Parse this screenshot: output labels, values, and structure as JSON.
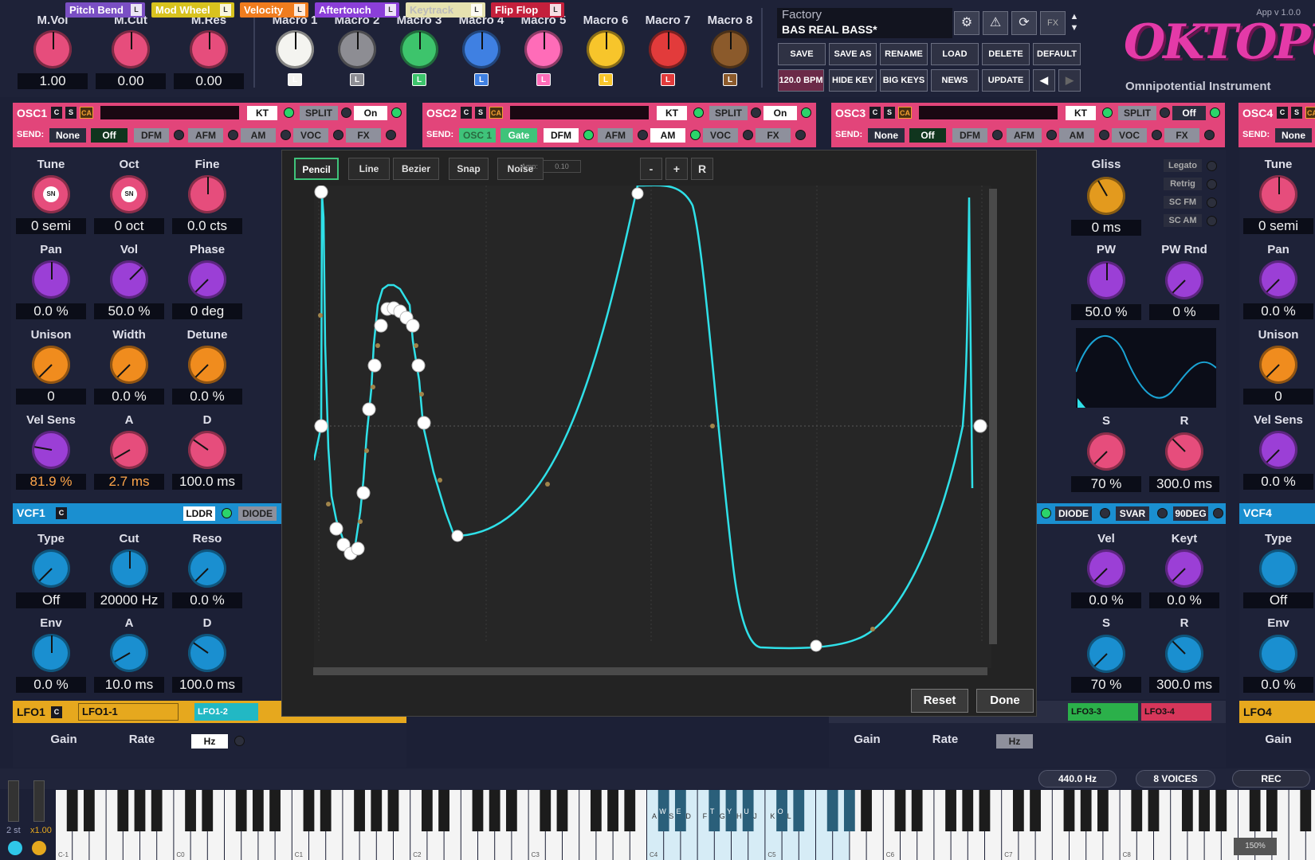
{
  "master": [
    {
      "label": "M.Vol",
      "value": "1.00"
    },
    {
      "label": "M.Cut",
      "value": "0.00"
    },
    {
      "label": "M.Res",
      "value": "0.00"
    }
  ],
  "macros": [
    {
      "label": "Macro 1",
      "badge": "L",
      "color": "#f4f4f0"
    },
    {
      "label": "Macro 2",
      "badge": "L",
      "color": "#8d8d93"
    },
    {
      "label": "Macro 3",
      "badge": "L",
      "color": "#3dc46c"
    },
    {
      "label": "Macro 4",
      "badge": "L",
      "color": "#3f80e2"
    },
    {
      "label": "Macro 5",
      "badge": "L",
      "color": "#ff6cb8"
    },
    {
      "label": "Macro 6",
      "badge": "L",
      "color": "#f7c52b"
    },
    {
      "label": "Macro 7",
      "badge": "L",
      "color": "#e23b3b"
    },
    {
      "label": "Macro 8",
      "badge": "L",
      "color": "#8b5a2b"
    }
  ],
  "preset": {
    "category": "Factory",
    "name": "BAS REAL BASS*",
    "fx": "FX"
  },
  "preset_buttons": [
    "SAVE",
    "SAVE AS",
    "RENAME",
    "LOAD",
    "DELETE",
    "DEFAULT"
  ],
  "preset_buttons2": [
    "120.0 BPM",
    "HIDE KEY",
    "BIG KEYS",
    "NEWS",
    "UPDATE"
  ],
  "logo": {
    "version": "App v 1.0.0",
    "word": "OKTOPUS",
    "subtitle": "Omnipotential Instrument"
  },
  "osc_heads": [
    {
      "title": "OSC1",
      "kt": "KT",
      "split": "SPLIT",
      "state": "On",
      "send_label": "SEND:",
      "send": "None",
      "send2": "Off",
      "b3": "DFM",
      "b4": "AFM",
      "b5": "AM",
      "b6": "VOC",
      "b7": "FX"
    },
    {
      "title": "OSC2",
      "kt": "KT",
      "split": "SPLIT",
      "state": "On",
      "send_label": "SEND:",
      "send": "OSC 1",
      "send2": "Gate",
      "b3": "DFM",
      "b4": "AFM",
      "b5": "AM",
      "b6": "VOC",
      "b7": "FX"
    },
    {
      "title": "OSC3",
      "kt": "KT",
      "split": "SPLIT",
      "state": "Off",
      "send_label": "SEND:",
      "send": "None",
      "send2": "Off",
      "b3": "DFM",
      "b4": "AFM",
      "b5": "AM",
      "b6": "VOC",
      "b7": "FX"
    },
    {
      "title": "OSC4",
      "send_label": "SEND:",
      "send": "None"
    }
  ],
  "osc1": {
    "row1": [
      {
        "label": "Tune",
        "value": "0 semi"
      },
      {
        "label": "Oct",
        "value": "0 oct"
      },
      {
        "label": "Fine",
        "value": "0.0 cts"
      }
    ],
    "row2": [
      {
        "label": "Pan",
        "value": "0.0 %"
      },
      {
        "label": "Vol",
        "value": "50.0 %"
      },
      {
        "label": "Phase",
        "value": "0 deg"
      }
    ],
    "row3": [
      {
        "label": "Unison",
        "value": "0"
      },
      {
        "label": "Width",
        "value": "0.0 %"
      },
      {
        "label": "Detune",
        "value": "0.0 %"
      }
    ],
    "row4": [
      {
        "label": "Vel Sens",
        "value": "81.9 %"
      },
      {
        "label": "A",
        "value": "2.7 ms"
      },
      {
        "label": "D",
        "value": "100.0 ms"
      }
    ],
    "knob_badge": "SN"
  },
  "vcf1": {
    "title": "VCF1",
    "c": "C",
    "ladder": "LDDR",
    "diode": "DIODE",
    "row1": [
      {
        "label": "Type",
        "value": "Off"
      },
      {
        "label": "Cut",
        "value": "20000 Hz"
      },
      {
        "label": "Reso",
        "value": "0.0 %"
      }
    ],
    "row2": [
      {
        "label": "Env",
        "value": "0.0 %"
      },
      {
        "label": "A",
        "value": "10.0 ms"
      },
      {
        "label": "D",
        "value": "100.0 ms"
      }
    ]
  },
  "osc3_right": {
    "gliss": "Gliss",
    "gliss_val": "0 ms",
    "modes": [
      "Legato",
      "Retrig",
      "SC FM",
      "SC AM"
    ],
    "pw": "PW",
    "pw_val": "50.0 %",
    "pwrnd": "PW Rnd",
    "pwrnd_val": "0 %",
    "s": "S",
    "s_val": "70 %",
    "r": "R",
    "r_val": "300.0 ms",
    "diode": "DIODE",
    "svar": "SVAR",
    "deg": "90DEG",
    "vel": "Vel",
    "vel_val": "0.0 %",
    "keyt": "Keyt",
    "keyt_val": "0.0 %",
    "s2_val": "70 %",
    "r2_val": "300.0 ms",
    "c": "C"
  },
  "osc4": {
    "row1": [
      {
        "label": "Tune",
        "value": "0 semi"
      },
      {
        "label": "Pan",
        "value": "0.0 %"
      },
      {
        "label": "Unison",
        "value": "0"
      },
      {
        "label": "Vel Sens",
        "value": "0.0 %"
      }
    ],
    "vcf": "VCF4",
    "type": "Type",
    "type_val": "Off",
    "env": "Env",
    "env_val": "0.0 %",
    "lfo": "LFO4",
    "gain": "Gain"
  },
  "lfo": {
    "lfo1": "LFO1",
    "c": "C",
    "lfo11": "LFO1-1",
    "lfo12": "LFO1-2",
    "lfo33": "LFO3-3",
    "lfo34": "LFO3-4",
    "gain": "Gain",
    "rate": "Rate",
    "hz": "Hz",
    "retrig": "Retrig"
  },
  "editor": {
    "tools": [
      "Pencil",
      "Line",
      "Bezier",
      "Snap",
      "Noise"
    ],
    "active_tool": "Pencil",
    "amp_label": "Amp:",
    "amp_value": "0.10",
    "zoom": [
      "-",
      "+",
      "R"
    ],
    "reset": "Reset",
    "done": "Done"
  },
  "modsources": [
    {
      "label": "Pitch Bend",
      "color": "#7a4fc4"
    },
    {
      "label": "Mod Wheel",
      "color": "#d8c21e"
    },
    {
      "label": "Velocity",
      "color": "#f07c1e"
    },
    {
      "label": "Aftertouch",
      "color": "#8b3fd8"
    },
    {
      "label": "Keytrack",
      "color": "#e6e2b0"
    },
    {
      "label": "Flip Flop",
      "color": "#c4203c"
    }
  ],
  "status": {
    "freq": "440.0 Hz",
    "voices": "8 VOICES",
    "rec": "REC",
    "pitch_range": "2 st",
    "mult": "x1.00",
    "zoom": "150%"
  },
  "keyboard": {
    "octaves": [
      "C-1",
      "C0",
      "C1",
      "C2",
      "C3",
      "C4",
      "C5",
      "C6",
      "C7",
      "C8"
    ],
    "white_letters": [
      "A",
      "S",
      "D",
      "F",
      "G",
      "H",
      "J",
      "K",
      "L"
    ],
    "black_letters": [
      "W",
      "E",
      "T",
      "Y",
      "U",
      "O"
    ]
  },
  "colors": {
    "accent_osc": "#e2457a",
    "accent_vcf": "#1a8fd0",
    "accent_lfo": "#e6a81e",
    "curve": "#2fe0e8",
    "active_tool": "#3fc37a"
  }
}
